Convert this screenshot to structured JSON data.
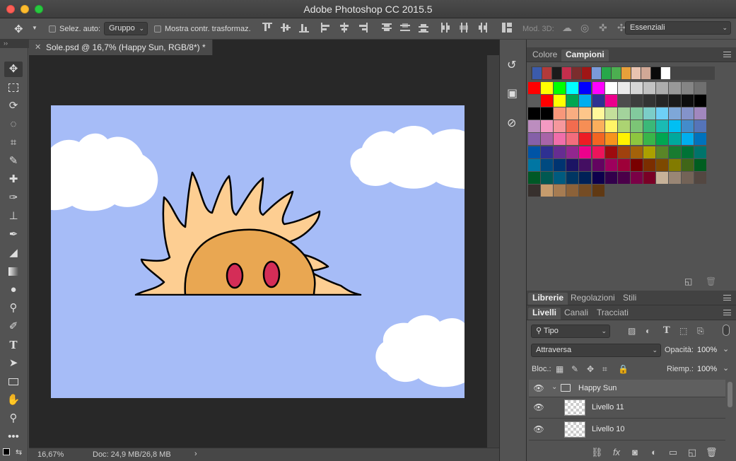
{
  "window": {
    "title": "Adobe Photoshop CC 2015.5"
  },
  "options_bar": {
    "auto_select_label": "Selez. auto:",
    "auto_select_value": "Gruppo",
    "show_transform_label": "Mostra contr. trasformaz.",
    "mode_3d_label": "Mod. 3D:",
    "workspace_value": "Essenziali"
  },
  "document": {
    "tab_label": "Sole.psd @ 16,7% (Happy Sun, RGB/8*) *",
    "zoom": "16,67%",
    "doc_size": "Doc: 24,9 MB/26,8 MB"
  },
  "color_panel": {
    "tabs": [
      "Colore",
      "Campioni"
    ],
    "active_tab": "Campioni",
    "recent_swatches": [
      "#3b5bab",
      "#b13a3a",
      "#1b1b1b",
      "#c42e4c",
      "#7b2d2d",
      "#a01616",
      "#7a9ad9",
      "#27a849",
      "#4caf50",
      "#e8a03a",
      "#e9c3b0",
      "#d1a896",
      "#0a0a0a",
      "#ffffff"
    ],
    "swatch_rows": [
      [
        "#ff0000",
        "#ffff00",
        "#00ff00",
        "#00ffff",
        "#0000ff",
        "#ff00ff",
        "#ffffff",
        "#ebebeb",
        "#d6d6d6",
        "#c2c2c2",
        "#adadad",
        "#999999",
        "#858585",
        "#707070"
      ],
      [
        "#5c5c5c",
        "#ff0000",
        "#ffff00",
        "#00a651",
        "#00aeef",
        "#2e3192",
        "#ec008c",
        "#4d4d4d",
        "#3d3d3d",
        "#333333",
        "#262626",
        "#1a1a1a",
        "#0d0d0d",
        "#000000"
      ],
      [
        "#000000",
        "#000000",
        "#f7977a",
        "#f9ad81",
        "#fdc68a",
        "#fff79a",
        "#c4df9b",
        "#a3d39c",
        "#82ca9d",
        "#7bcdc8",
        "#6ecff6",
        "#7ea7d8",
        "#8493ca",
        "#a187be"
      ],
      [
        "#bc8dbf",
        "#f49ac2",
        "#f6989d",
        "#f26c4f",
        "#f68e55",
        "#fbaf5c",
        "#fff467",
        "#acd372",
        "#7cc576",
        "#3bb878",
        "#1abbb4",
        "#00bff3",
        "#438ccb",
        "#5574b9"
      ],
      [
        "#8560a8",
        "#a864a8",
        "#f06eaa",
        "#f26d7d",
        "#ed1c24",
        "#f26522",
        "#f7941d",
        "#fff200",
        "#8dc63f",
        "#39b54a",
        "#00a651",
        "#00a99d",
        "#00aeef",
        "#0072bc"
      ],
      [
        "#0054a6",
        "#2e3192",
        "#662d91",
        "#92278f",
        "#ec008c",
        "#ed145b",
        "#9e0b0f",
        "#a0410d",
        "#a3620a",
        "#aba000",
        "#598527",
        "#197b30",
        "#007236",
        "#00746b"
      ],
      [
        "#0076a3",
        "#004a80",
        "#003471",
        "#1b1464",
        "#440e62",
        "#630460",
        "#9e005d",
        "#9e0039",
        "#790000",
        "#7b2e00",
        "#7d4900",
        "#827b00",
        "#406618",
        "#005e20"
      ],
      [
        "#005826",
        "#005952",
        "#005b7f",
        "#003663",
        "#002157",
        "#0d004c",
        "#32004b",
        "#4b0049",
        "#7b0046",
        "#7a0026",
        "#c7b299",
        "#998675",
        "#736357",
        "#534741"
      ],
      [
        "#37302d",
        "#c69c6d",
        "#a67c52",
        "#8c6239",
        "#754c24",
        "#603913"
      ]
    ]
  },
  "libraries_tabs": [
    "Librerie",
    "Regolazioni",
    "Stili"
  ],
  "layers_panel": {
    "tabs": [
      "Livelli",
      "Canali",
      "Tracciati"
    ],
    "filter_value": "Tipo",
    "blend_mode": "Attraversa",
    "opacity_label": "Opacità:",
    "opacity_value": "100%",
    "lock_label": "Bloc.:",
    "fill_label": "Riemp.:",
    "fill_value": "100%",
    "layers": [
      {
        "name": "Happy Sun",
        "kind": "group"
      },
      {
        "name": "Livello 11",
        "kind": "layer"
      },
      {
        "name": "Livello 10",
        "kind": "layer"
      }
    ]
  },
  "icons": [
    "move-icon",
    "marquee-icon",
    "lasso-icon",
    "quick-select-icon",
    "crop-icon",
    "eyedropper-icon",
    "healing-icon",
    "brush-icon",
    "stamp-icon",
    "history-brush-icon",
    "eraser-icon",
    "gradient-icon",
    "blur-icon",
    "dodge-icon",
    "pen-icon",
    "type-icon",
    "path-select-icon",
    "rectangle-icon",
    "hand-icon",
    "zoom-icon",
    "more-icon"
  ],
  "colors": {
    "sky": "#a6bcf7",
    "sun_rays": "#fdce92",
    "sun_face": "#e9a752",
    "sun_eyes": "#d42d57",
    "cloud": "#ffffff"
  }
}
